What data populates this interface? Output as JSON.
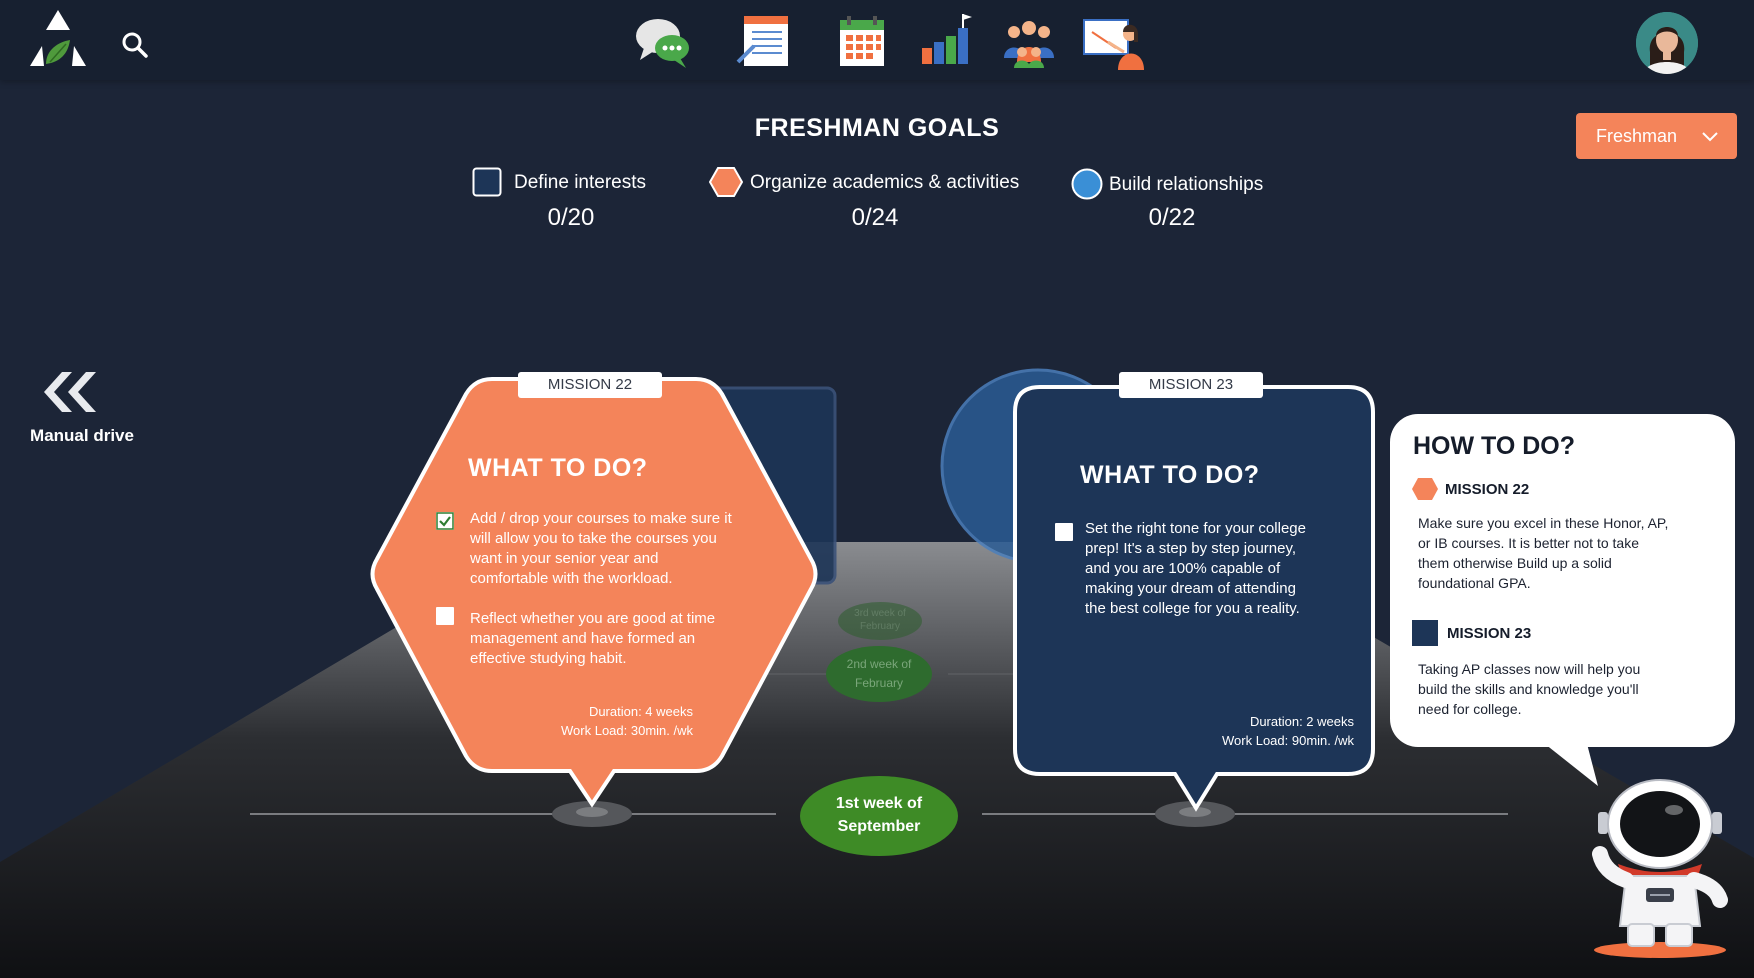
{
  "header": {
    "nav_icons": [
      "logo-icon",
      "search-icon",
      "chat-icon",
      "notes-icon",
      "calendar-icon",
      "progress-chart-icon",
      "group-icon",
      "presentation-icon",
      "user-avatar-icon"
    ]
  },
  "page_title": "FRESHMAN GOALS",
  "grade_select": {
    "value": "Freshman"
  },
  "goals": [
    {
      "label": "Define interests",
      "count": "0/20",
      "icon": "square-goal-icon",
      "color": "#1d3557"
    },
    {
      "label": "Organize academics & activities",
      "count": "0/24",
      "icon": "hexagon-goal-icon",
      "color": "#f4845a"
    },
    {
      "label": "Build relationships",
      "count": "0/22",
      "icon": "circle-goal-icon",
      "color": "#3a8fd6"
    }
  ],
  "manual_drive": {
    "label": "Manual drive"
  },
  "road": {
    "milestones": [
      {
        "label_line1": "1st week of",
        "label_line2": "September"
      },
      {
        "label_line1": "2nd week of",
        "label_line2": "February"
      },
      {
        "label_line1": "3rd week of",
        "label_line2": "February"
      }
    ]
  },
  "missions": [
    {
      "badge": "MISSION 22",
      "title": "WHAT TO DO?",
      "tasks": [
        {
          "checked": true,
          "lines": [
            "Add / drop your courses to make sure it",
            "will allow you to take the courses you",
            "want in your senior year and",
            "comfortable with the workload."
          ]
        },
        {
          "checked": false,
          "lines": [
            "Reflect whether you are good at time",
            "management and have formed an",
            "effective studying habit."
          ]
        }
      ],
      "duration": "Duration: 4 weeks",
      "workload": "Work Load: 30min. /wk",
      "color": "#f4845a"
    },
    {
      "badge": "MISSION 23",
      "title": "WHAT TO DO?",
      "tasks": [
        {
          "checked": false,
          "lines": [
            "Set the right tone for your college",
            "prep! It's a step by step journey,",
            "and you are 100% capable of",
            "making your dream of attending",
            "the best college for you a reality."
          ]
        }
      ],
      "duration": "Duration: 2 weeks",
      "workload": "Work Load: 90min. /wk",
      "color": "#1d3557"
    }
  ],
  "how_to": {
    "title": "HOW TO DO?",
    "items": [
      {
        "name": "MISSION 22",
        "icon": "hexagon-mission-icon",
        "lines": [
          "Make sure you excel in these Honor, AP,",
          "or IB courses. It is better not to take",
          "them otherwise Build up a solid",
          "foundational GPA."
        ]
      },
      {
        "name": "MISSION 23",
        "icon": "square-mission-icon",
        "lines": [
          "Taking AP classes now will help you",
          "build the skills and knowledge you'll",
          "need for college."
        ]
      }
    ]
  },
  "mascot": {
    "icon": "astronaut-icon"
  }
}
